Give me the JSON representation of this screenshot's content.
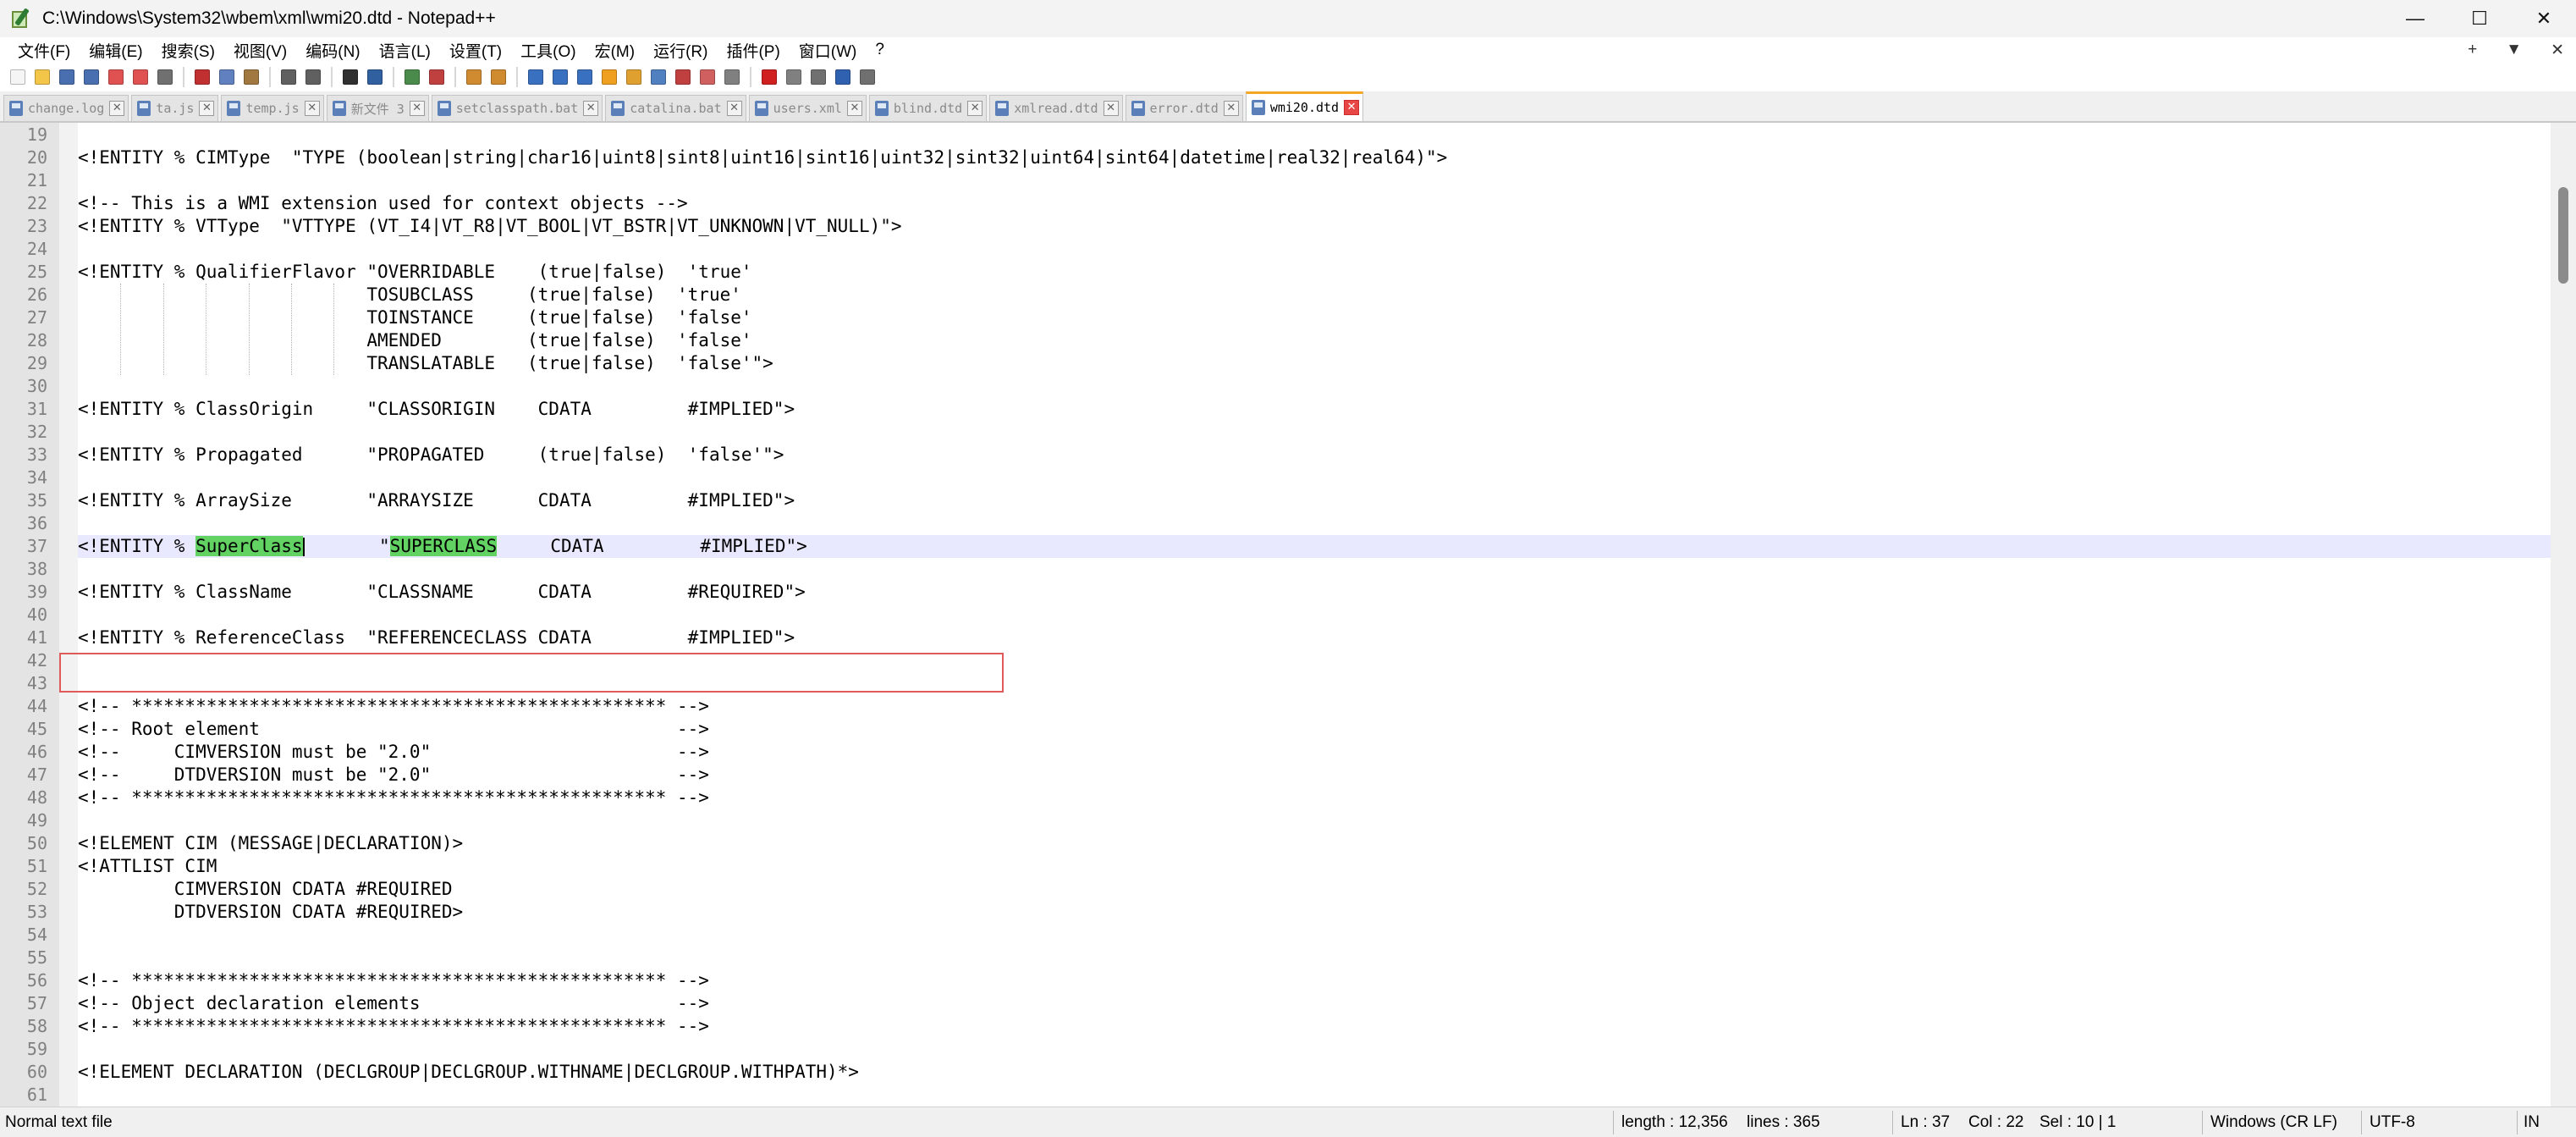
{
  "window": {
    "title": "C:\\Windows\\System32\\wbem\\xml\\wmi20.dtd - Notepad++",
    "minimize": "—",
    "maximize": "☐",
    "close": "✕"
  },
  "menu": {
    "items": [
      "文件(F)",
      "编辑(E)",
      "搜索(S)",
      "视图(V)",
      "编码(N)",
      "语言(L)",
      "设置(T)",
      "工具(O)",
      "宏(M)",
      "运行(R)",
      "插件(P)",
      "窗口(W)",
      "?"
    ],
    "right": {
      "plus": "+",
      "dropdown": "▼",
      "close": "✕"
    }
  },
  "toolbar": {
    "buttons": [
      {
        "icon": "new-file-icon",
        "color": "#f5f5f5"
      },
      {
        "icon": "open-file-icon",
        "color": "#f3c64a"
      },
      {
        "icon": "save-icon",
        "color": "#4a6fb0"
      },
      {
        "icon": "save-all-icon",
        "color": "#4a6fb0"
      },
      {
        "icon": "close-file-icon",
        "color": "#e05252"
      },
      {
        "icon": "close-all-icon",
        "color": "#e05252"
      },
      {
        "icon": "print-icon",
        "color": "#707070"
      },
      {
        "sep": true
      },
      {
        "icon": "cut-icon",
        "color": "#c03030"
      },
      {
        "icon": "copy-icon",
        "color": "#6080c0"
      },
      {
        "icon": "paste-icon",
        "color": "#a07840"
      },
      {
        "sep": true
      },
      {
        "icon": "undo-icon",
        "color": "#606060"
      },
      {
        "icon": "redo-icon",
        "color": "#606060"
      },
      {
        "sep": true
      },
      {
        "icon": "find-icon",
        "color": "#303030"
      },
      {
        "icon": "replace-icon",
        "color": "#3060a0"
      },
      {
        "sep": true
      },
      {
        "icon": "zoom-in-icon",
        "color": "#4a8a4a"
      },
      {
        "icon": "zoom-out-icon",
        "color": "#c04040"
      },
      {
        "sep": true
      },
      {
        "icon": "sync-vertical-icon",
        "color": "#d08a30"
      },
      {
        "icon": "sync-horizontal-icon",
        "color": "#d08a30"
      },
      {
        "sep": true
      },
      {
        "icon": "word-wrap-icon",
        "color": "#3a70c0"
      },
      {
        "icon": "show-all-chars-icon",
        "color": "#3a70c0"
      },
      {
        "icon": "indent-guide-icon",
        "color": "#3a70c0"
      },
      {
        "icon": "udl-icon",
        "color": "#f0a020"
      },
      {
        "icon": "doc-map-icon",
        "color": "#e0a030"
      },
      {
        "icon": "doc-list-icon",
        "color": "#5080c0"
      },
      {
        "icon": "function-list-icon",
        "color": "#c04040"
      },
      {
        "icon": "folder-workspace-icon",
        "color": "#d06060"
      },
      {
        "icon": "monitoring-icon",
        "color": "#808080"
      },
      {
        "sep": true
      },
      {
        "icon": "record-macro-icon",
        "color": "#d02020"
      },
      {
        "icon": "stop-record-icon",
        "color": "#808080"
      },
      {
        "icon": "playback-icon",
        "color": "#707070"
      },
      {
        "icon": "run-macro-multiple-icon",
        "color": "#3060b0"
      },
      {
        "icon": "save-macro-icon",
        "color": "#707070"
      }
    ]
  },
  "tabs": [
    {
      "label": "change.log",
      "active": false
    },
    {
      "label": "ta.js",
      "active": false
    },
    {
      "label": "temp.js",
      "active": false
    },
    {
      "label": "新文件 3",
      "active": false
    },
    {
      "label": "setclasspath.bat",
      "active": false
    },
    {
      "label": "catalina.bat",
      "active": false
    },
    {
      "label": "users.xml",
      "active": false
    },
    {
      "label": "blind.dtd",
      "active": false
    },
    {
      "label": "xmlread.dtd",
      "active": false
    },
    {
      "label": "error.dtd",
      "active": false
    },
    {
      "label": "wmi20.dtd",
      "active": true
    }
  ],
  "editor": {
    "current_line": 37,
    "lines": [
      {
        "n": "19",
        "t": ""
      },
      {
        "n": "20",
        "t": "<!ENTITY % CIMType  \"TYPE (boolean|string|char16|uint8|sint8|uint16|sint16|uint32|sint32|uint64|sint64|datetime|real32|real64)\">"
      },
      {
        "n": "21",
        "t": ""
      },
      {
        "n": "22",
        "t": "<!-- This is a WMI extension used for context objects -->"
      },
      {
        "n": "23",
        "t": "<!ENTITY % VTType  \"VTTYPE (VT_I4|VT_R8|VT_BOOL|VT_BSTR|VT_UNKNOWN|VT_NULL)\">"
      },
      {
        "n": "24",
        "t": ""
      },
      {
        "n": "25",
        "t": "<!ENTITY % QualifierFlavor \"OVERRIDABLE    (true|false)  'true'"
      },
      {
        "n": "26",
        "t": "                           TOSUBCLASS     (true|false)  'true'"
      },
      {
        "n": "27",
        "t": "                           TOINSTANCE     (true|false)  'false'"
      },
      {
        "n": "28",
        "t": "                           AMENDED        (true|false)  'false'"
      },
      {
        "n": "29",
        "t": "                           TRANSLATABLE   (true|false)  'false'\">"
      },
      {
        "n": "30",
        "t": ""
      },
      {
        "n": "31",
        "t": "<!ENTITY % ClassOrigin     \"CLASSORIGIN    CDATA         #IMPLIED\">"
      },
      {
        "n": "32",
        "t": ""
      },
      {
        "n": "33",
        "t": "<!ENTITY % Propagated      \"PROPAGATED     (true|false)  'false'\">"
      },
      {
        "n": "34",
        "t": ""
      },
      {
        "n": "35",
        "t": "<!ENTITY % ArraySize       \"ARRAYSIZE      CDATA         #IMPLIED\">"
      },
      {
        "n": "36",
        "t": ""
      },
      {
        "n": "37",
        "t": "",
        "parts": [
          "<!ENTITY % ",
          "SuperClass",
          "       \"",
          "SUPERCLASS",
          "     CDATA         #IMPLIED\">"
        ]
      },
      {
        "n": "38",
        "t": ""
      },
      {
        "n": "39",
        "t": "<!ENTITY % ClassName       \"CLASSNAME      CDATA         #REQUIRED\">"
      },
      {
        "n": "40",
        "t": ""
      },
      {
        "n": "41",
        "t": "<!ENTITY % ReferenceClass  \"REFERENCECLASS CDATA         #IMPLIED\">"
      },
      {
        "n": "42",
        "t": ""
      },
      {
        "n": "43",
        "t": ""
      },
      {
        "n": "44",
        "t": "<!-- ************************************************** -->"
      },
      {
        "n": "45",
        "t": "<!-- Root element                                       -->"
      },
      {
        "n": "46",
        "t": "<!--     CIMVERSION must be \"2.0\"                       -->"
      },
      {
        "n": "47",
        "t": "<!--     DTDVERSION must be \"2.0\"                       -->"
      },
      {
        "n": "48",
        "t": "<!-- ************************************************** -->"
      },
      {
        "n": "49",
        "t": ""
      },
      {
        "n": "50",
        "t": "<!ELEMENT CIM (MESSAGE|DECLARATION)>"
      },
      {
        "n": "51",
        "t": "<!ATTLIST CIM"
      },
      {
        "n": "52",
        "t": "         CIMVERSION CDATA #REQUIRED"
      },
      {
        "n": "53",
        "t": "         DTDVERSION CDATA #REQUIRED>"
      },
      {
        "n": "54",
        "t": ""
      },
      {
        "n": "55",
        "t": ""
      },
      {
        "n": "56",
        "t": "<!-- ************************************************** -->"
      },
      {
        "n": "57",
        "t": "<!-- Object declaration elements                        -->"
      },
      {
        "n": "58",
        "t": "<!-- ************************************************** -->"
      },
      {
        "n": "59",
        "t": ""
      },
      {
        "n": "60",
        "t": "<!ELEMENT DECLARATION (DECLGROUP|DECLGROUP.WITHNAME|DECLGROUP.WITHPATH)*>"
      },
      {
        "n": "61",
        "t": ""
      }
    ]
  },
  "status": {
    "file_type": "Normal text file",
    "length": "length : 12,356",
    "lines": "lines : 365",
    "ln": "Ln : 37",
    "col": "Col : 22",
    "sel": "Sel : 10 | 1",
    "eol": "Windows (CR LF)",
    "encoding": "UTF-8",
    "ins": "IN"
  }
}
